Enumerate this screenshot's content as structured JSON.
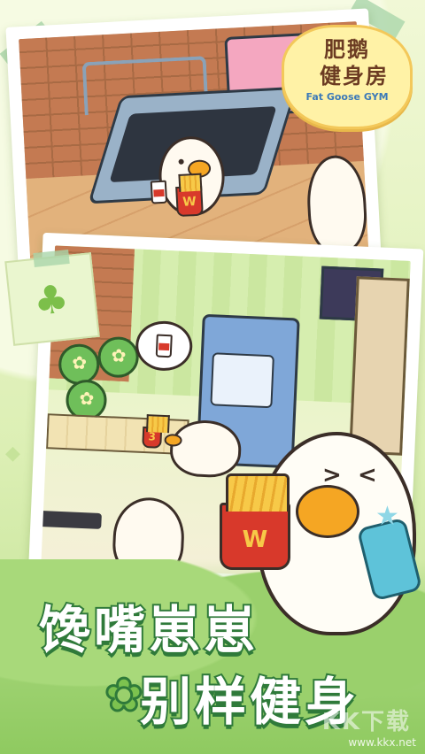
{
  "logo": {
    "line1": "肥鹅",
    "line2": "健身房",
    "subtitle": "Fat Goose GYM"
  },
  "scene_top": {
    "fries_mark": "W"
  },
  "scene_bottom": {
    "sign_number": "3"
  },
  "foreground": {
    "fries_mark": "W"
  },
  "slogan": {
    "line1": "馋嘴崽崽",
    "line2": "别样健身"
  },
  "watermark": {
    "brand": "KK下载",
    "url": "www.kkx.net"
  },
  "colors": {
    "accent_green": "#2f7a3a",
    "duck_body": "#fffdf6",
    "beak": "#f5a623",
    "logo_bg": "#fff2a6"
  },
  "icons": [
    "clover-icon",
    "star-icon",
    "phone-icon"
  ]
}
